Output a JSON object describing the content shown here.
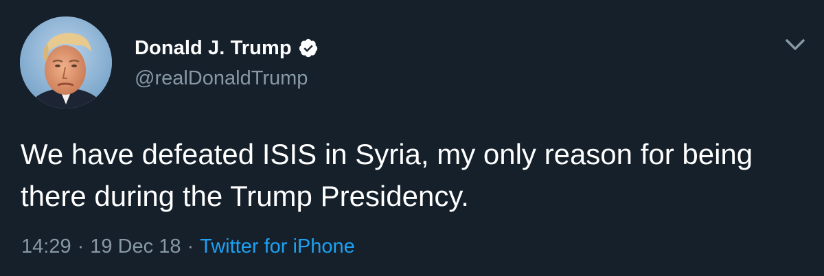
{
  "author": {
    "display_name": "Donald J. Trump",
    "handle": "@realDonaldTrump",
    "verified": true,
    "avatar_icon": "profile-photo",
    "verified_icon": "verified-badge-icon"
  },
  "tweet": {
    "text": "We have defeated ISIS in Syria, my only reason for being there during the Trump Presidency.",
    "time": "14:29",
    "date": "19 Dec 18",
    "separator": "·",
    "source": "Twitter for iPhone"
  },
  "menu": {
    "icon": "chevron-down-icon"
  },
  "colors": {
    "background": "#15202b",
    "text_primary": "#ffffff",
    "text_secondary": "#8899a6",
    "accent": "#1da1f2"
  }
}
